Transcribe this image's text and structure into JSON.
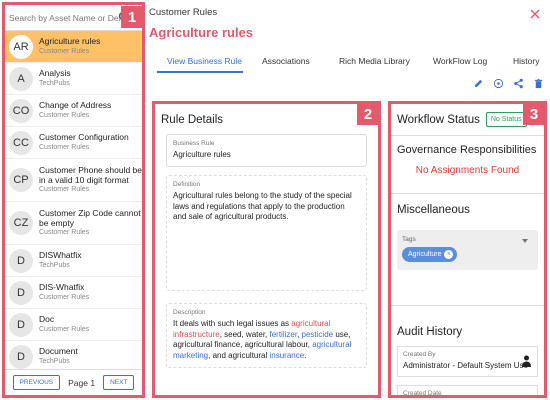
{
  "search": {
    "placeholder": "Search by Asset Name or Definition"
  },
  "section_badges": {
    "left": "1",
    "details": "2",
    "workflow": "3"
  },
  "asset_list": [
    {
      "initials": "AR",
      "name": "Agriculture rules",
      "sub": "Customer Rules",
      "selected": true
    },
    {
      "initials": "A",
      "name": "Analysis",
      "sub": "TechPubs"
    },
    {
      "initials": "CO",
      "name": "Change of Address",
      "sub": "Customer Rules"
    },
    {
      "initials": "CC",
      "name": "Customer Configuration",
      "sub": "Customer Rules"
    },
    {
      "initials": "CP",
      "name": "Customer Phone should be in a valid 10 digit format",
      "sub": "Customer Rules"
    },
    {
      "initials": "CZ",
      "name": "Customer Zip Code cannot be empty",
      "sub": "Customer Rules"
    },
    {
      "initials": "D",
      "name": "DISWhatfix",
      "sub": "TechPubs"
    },
    {
      "initials": "D",
      "name": "DIS-Whatfix",
      "sub": "Customer Rules"
    },
    {
      "initials": "D",
      "name": "Doc",
      "sub": "Customer Rules"
    },
    {
      "initials": "D",
      "name": "Document",
      "sub": "TechPubs"
    }
  ],
  "pager": {
    "prev": "PREVIOUS",
    "label": "Page 1",
    "next": "NEXT"
  },
  "header": {
    "breadcrumb": "Customer Rules",
    "title": "Agriculture rules"
  },
  "tabs": [
    "View Business Rule",
    "Associations",
    "Rich Media Library",
    "WorkFlow Log",
    "History"
  ],
  "details": {
    "heading": "Rule Details",
    "business_rule_label": "Business Rule",
    "business_rule_value": "Agriculture rules",
    "definition_label": "Definition",
    "definition_value": "Agricultural rules belong to  the study of the special laws and regulations that apply to the production and sale of agricultural products.",
    "description_label": "Description",
    "description_parts": {
      "p1": "It deals with such legal issues as ",
      "l1": "agricultural infrastructure",
      "p2": ", seed, water, ",
      "l2": "fertilizer",
      "p3": ", ",
      "l3": "pesticide",
      "p4": " use, agricultural finance, agricultural labour, ",
      "l4": "agricultural marketing",
      "p5": ", and agricultural ",
      "l5": "insurance",
      "p6": "."
    }
  },
  "workflow": {
    "heading": "Workflow Status",
    "status": "No Status",
    "gov_heading": "Governance Responsibilities",
    "no_assign": "No Assignments Found",
    "misc_heading": "Miscellaneous",
    "tags_label": "Tags",
    "tag": "Agriculture",
    "audit_heading": "Audit History",
    "created_by_label": "Created By",
    "created_by_value": "Administrator - Default System Use",
    "created_date_label": "Created Date"
  },
  "colors": {
    "accent": "#e35a6c",
    "link": "#3b6fd2",
    "selected": "#ffc166",
    "status": "#2e9b5a",
    "error": "#e53935"
  },
  "icons": [
    "search-icon",
    "close-icon",
    "edit-icon",
    "share-network-icon",
    "share-icon",
    "delete-icon",
    "person-icon"
  ]
}
